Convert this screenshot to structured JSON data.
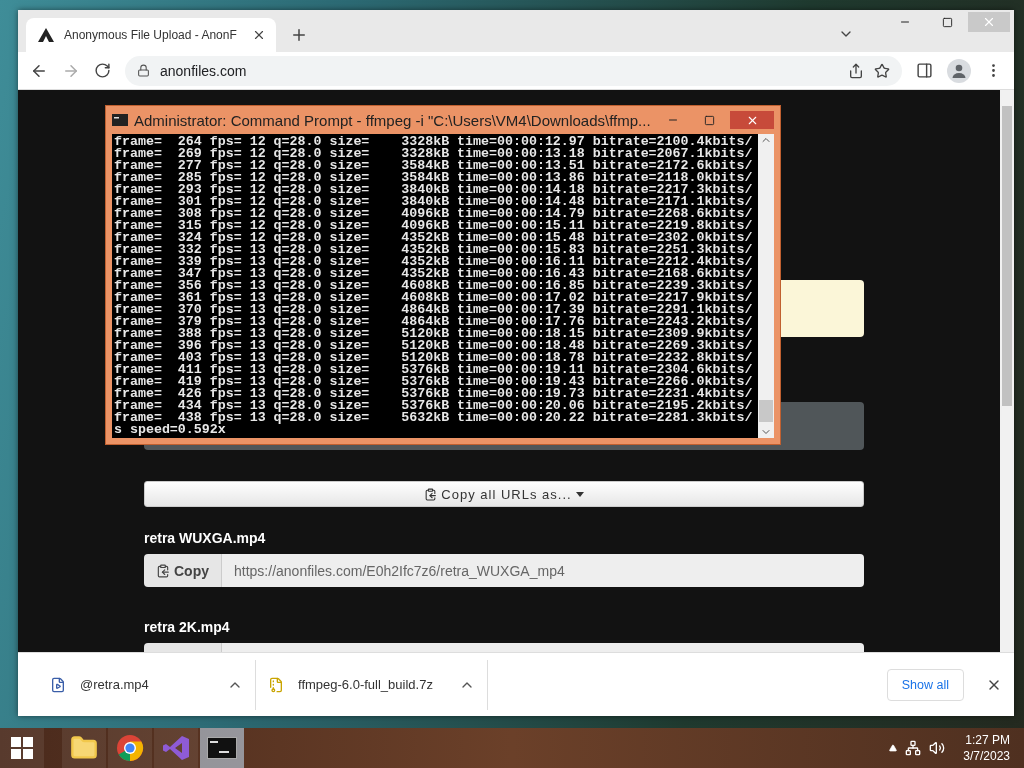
{
  "browser": {
    "tab_title": "Anonymous File Upload - AnonF",
    "address": "anonfiles.com"
  },
  "page": {
    "copy_all_button": "Copy all URLs as...",
    "files": [
      {
        "name": "retra WUXGA.mp4",
        "copy_label": "Copy",
        "url": "https://anonfiles.com/E0h2Ifc7z6/retra_WUXGA_mp4"
      },
      {
        "name": "retra 2K.mp4"
      }
    ]
  },
  "console": {
    "title": "Administrator:  Command Prompt - ffmpeg  -i \"C:\\Users\\VM4\\Downloads\\ffmp...",
    "lines": [
      "frame=  264 fps= 12 q=28.0 size=    3328kB time=00:00:12.97 bitrate=2100.4kbits/",
      "frame=  269 fps= 12 q=28.0 size=    3328kB time=00:00:13.18 bitrate=2067.1kbits/",
      "frame=  277 fps= 12 q=28.0 size=    3584kB time=00:00:13.51 bitrate=2172.6kbits/",
      "frame=  285 fps= 12 q=28.0 size=    3584kB time=00:00:13.86 bitrate=2118.0kbits/",
      "frame=  293 fps= 12 q=28.0 size=    3840kB time=00:00:14.18 bitrate=2217.3kbits/",
      "frame=  301 fps= 12 q=28.0 size=    3840kB time=00:00:14.48 bitrate=2171.1kbits/",
      "frame=  308 fps= 12 q=28.0 size=    4096kB time=00:00:14.79 bitrate=2268.6kbits/",
      "frame=  315 fps= 12 q=28.0 size=    4096kB time=00:00:15.11 bitrate=2219.8kbits/",
      "frame=  324 fps= 12 q=28.0 size=    4352kB time=00:00:15.48 bitrate=2302.0kbits/",
      "frame=  332 fps= 13 q=28.0 size=    4352kB time=00:00:15.83 bitrate=2251.3kbits/",
      "frame=  339 fps= 13 q=28.0 size=    4352kB time=00:00:16.11 bitrate=2212.4kbits/",
      "frame=  347 fps= 13 q=28.0 size=    4352kB time=00:00:16.43 bitrate=2168.6kbits/",
      "frame=  356 fps= 13 q=28.0 size=    4608kB time=00:00:16.85 bitrate=2239.3kbits/",
      "frame=  361 fps= 13 q=28.0 size=    4608kB time=00:00:17.02 bitrate=2217.9kbits/",
      "frame=  370 fps= 13 q=28.0 size=    4864kB time=00:00:17.39 bitrate=2291.1kbits/",
      "frame=  379 fps= 13 q=28.0 size=    4864kB time=00:00:17.76 bitrate=2243.2kbits/",
      "frame=  388 fps= 13 q=28.0 size=    5120kB time=00:00:18.15 bitrate=2309.9kbits/",
      "frame=  396 fps= 13 q=28.0 size=    5120kB time=00:00:18.48 bitrate=2269.3kbits/",
      "frame=  403 fps= 13 q=28.0 size=    5120kB time=00:00:18.78 bitrate=2232.8kbits/",
      "frame=  411 fps= 13 q=28.0 size=    5376kB time=00:00:19.11 bitrate=2304.6kbits/",
      "frame=  419 fps= 13 q=28.0 size=    5376kB time=00:00:19.43 bitrate=2266.0kbits/",
      "frame=  426 fps= 13 q=28.0 size=    5376kB time=00:00:19.73 bitrate=2231.4kbits/",
      "frame=  434 fps= 13 q=28.0 size=    5376kB time=00:00:20.06 bitrate=2195.2kbits/",
      "frame=  438 fps= 13 q=28.0 size=    5632kB time=00:00:20.22 bitrate=2281.3kbits/",
      "s speed=0.592x"
    ]
  },
  "downloads": {
    "items": [
      {
        "name": "@retra.mp4",
        "kind": "video"
      },
      {
        "name": "ffmpeg-6.0-full_build.7z",
        "kind": "archive"
      }
    ],
    "show_all": "Show all"
  },
  "taskbar": {
    "apps": [
      {
        "kind": "explorer",
        "selected": false
      },
      {
        "kind": "chrome",
        "selected": false
      },
      {
        "kind": "studio",
        "selected": false
      },
      {
        "kind": "console",
        "selected": true
      }
    ],
    "time": "1:27 PM",
    "date": "3/7/2023"
  }
}
